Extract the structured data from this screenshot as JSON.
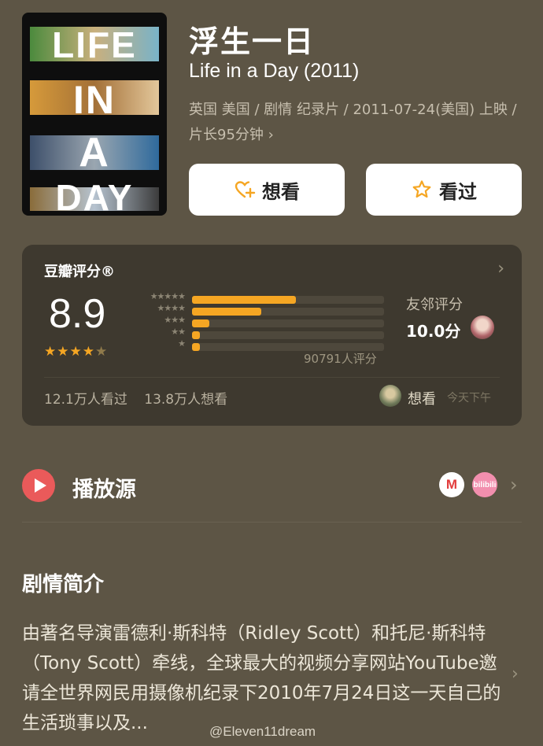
{
  "movie": {
    "title": "浮生一日",
    "original_title": "Life in a Day (2011)",
    "meta": "英国 美国 / 剧情 纪录片 / 2011-07-24(美国) 上映 / 片长95分钟 ›",
    "poster_words": [
      "LIFE",
      "IN",
      "A",
      "DAY"
    ]
  },
  "actions": {
    "want_label": "想看",
    "seen_label": "看过"
  },
  "rating": {
    "title": "豆瓣评分®",
    "score": "8.9",
    "stars": 4.5,
    "distribution": [
      {
        "stars": "★★★★★",
        "fraction": 0.54
      },
      {
        "stars": "★★★★",
        "fraction": 0.36
      },
      {
        "stars": "★★★",
        "fraction": 0.09
      },
      {
        "stars": "★★",
        "fraction": 0.04
      },
      {
        "stars": "★",
        "fraction": 0.04
      }
    ],
    "count": "90791人评分",
    "friend_label": "友邻评分",
    "friend_score": "10.0分",
    "seen_count": "12.1万人看过",
    "want_count": "13.8万人想看",
    "friend_activity": "想看",
    "friend_activity_time": "今天下午"
  },
  "source": {
    "label": "播放源",
    "logo1": "M",
    "logo2": "bilibili"
  },
  "synopsis": {
    "title": "剧情简介",
    "text": "由著名导演雷德利·斯科特（Ridley Scott）和托尼·斯科特（Tony Scott）牵线，全球最大的视频分享网站YouTube邀请全世界网民用摄像机纪录下2010年7月24日这一天自己的生活琐事以及..."
  },
  "watermark": "@Eleven11dream",
  "colors": {
    "background": "#5d5545",
    "card": "#3e392f",
    "accent": "#f5a623",
    "play": "#ea5a5a"
  }
}
